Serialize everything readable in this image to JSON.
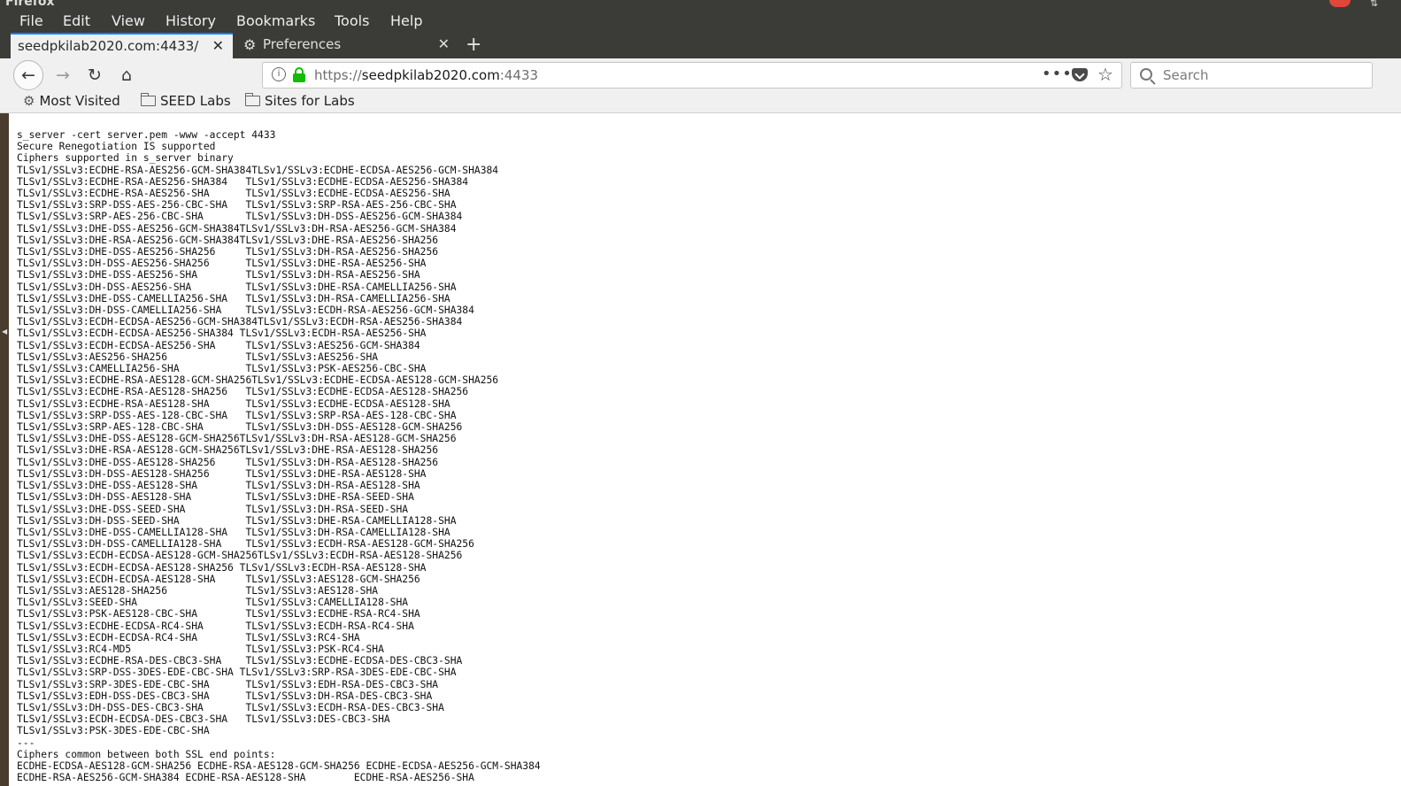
{
  "window": {
    "title": "Firefox"
  },
  "menu": [
    "File",
    "Edit",
    "View",
    "History",
    "Bookmarks",
    "Tools",
    "Help"
  ],
  "tabs": [
    {
      "label": "seedpkilab2020.com:4433/",
      "active": true
    },
    {
      "label": "Preferences",
      "active": false,
      "icon": "gear-icon"
    }
  ],
  "urlbar": {
    "scheme": "https://",
    "host": "seedpkilab2020.com",
    "port": ":4433",
    "page_actions": "•••"
  },
  "search": {
    "placeholder": "Search"
  },
  "bookmarks": [
    {
      "label": "Most Visited",
      "icon": "gear-icon"
    },
    {
      "label": "SEED Labs",
      "icon": "folder-icon"
    },
    {
      "label": "Sites for Labs",
      "icon": "folder-icon"
    }
  ],
  "page": {
    "lines": [
      "s_server -cert server.pem -www -accept 4433",
      "Secure Renegotiation IS supported",
      "Ciphers supported in s_server binary",
      "TLSv1/SSLv3:ECDHE-RSA-AES256-GCM-SHA384TLSv1/SSLv3:ECDHE-ECDSA-AES256-GCM-SHA384",
      "TLSv1/SSLv3:ECDHE-RSA-AES256-SHA384   TLSv1/SSLv3:ECDHE-ECDSA-AES256-SHA384",
      "TLSv1/SSLv3:ECDHE-RSA-AES256-SHA      TLSv1/SSLv3:ECDHE-ECDSA-AES256-SHA",
      "TLSv1/SSLv3:SRP-DSS-AES-256-CBC-SHA   TLSv1/SSLv3:SRP-RSA-AES-256-CBC-SHA",
      "TLSv1/SSLv3:SRP-AES-256-CBC-SHA       TLSv1/SSLv3:DH-DSS-AES256-GCM-SHA384",
      "TLSv1/SSLv3:DHE-DSS-AES256-GCM-SHA384TLSv1/SSLv3:DH-RSA-AES256-GCM-SHA384",
      "TLSv1/SSLv3:DHE-RSA-AES256-GCM-SHA384TLSv1/SSLv3:DHE-RSA-AES256-SHA256",
      "TLSv1/SSLv3:DHE-DSS-AES256-SHA256     TLSv1/SSLv3:DH-RSA-AES256-SHA256",
      "TLSv1/SSLv3:DH-DSS-AES256-SHA256      TLSv1/SSLv3:DHE-RSA-AES256-SHA",
      "TLSv1/SSLv3:DHE-DSS-AES256-SHA        TLSv1/SSLv3:DH-RSA-AES256-SHA",
      "TLSv1/SSLv3:DH-DSS-AES256-SHA         TLSv1/SSLv3:DHE-RSA-CAMELLIA256-SHA",
      "TLSv1/SSLv3:DHE-DSS-CAMELLIA256-SHA   TLSv1/SSLv3:DH-RSA-CAMELLIA256-SHA",
      "TLSv1/SSLv3:DH-DSS-CAMELLIA256-SHA    TLSv1/SSLv3:ECDH-RSA-AES256-GCM-SHA384",
      "TLSv1/SSLv3:ECDH-ECDSA-AES256-GCM-SHA384TLSv1/SSLv3:ECDH-RSA-AES256-SHA384",
      "TLSv1/SSLv3:ECDH-ECDSA-AES256-SHA384 TLSv1/SSLv3:ECDH-RSA-AES256-SHA",
      "TLSv1/SSLv3:ECDH-ECDSA-AES256-SHA     TLSv1/SSLv3:AES256-GCM-SHA384",
      "TLSv1/SSLv3:AES256-SHA256             TLSv1/SSLv3:AES256-SHA",
      "TLSv1/SSLv3:CAMELLIA256-SHA           TLSv1/SSLv3:PSK-AES256-CBC-SHA",
      "TLSv1/SSLv3:ECDHE-RSA-AES128-GCM-SHA256TLSv1/SSLv3:ECDHE-ECDSA-AES128-GCM-SHA256",
      "TLSv1/SSLv3:ECDHE-RSA-AES128-SHA256   TLSv1/SSLv3:ECDHE-ECDSA-AES128-SHA256",
      "TLSv1/SSLv3:ECDHE-RSA-AES128-SHA      TLSv1/SSLv3:ECDHE-ECDSA-AES128-SHA",
      "TLSv1/SSLv3:SRP-DSS-AES-128-CBC-SHA   TLSv1/SSLv3:SRP-RSA-AES-128-CBC-SHA",
      "TLSv1/SSLv3:SRP-AES-128-CBC-SHA       TLSv1/SSLv3:DH-DSS-AES128-GCM-SHA256",
      "TLSv1/SSLv3:DHE-DSS-AES128-GCM-SHA256TLSv1/SSLv3:DH-RSA-AES128-GCM-SHA256",
      "TLSv1/SSLv3:DHE-RSA-AES128-GCM-SHA256TLSv1/SSLv3:DHE-RSA-AES128-SHA256",
      "TLSv1/SSLv3:DHE-DSS-AES128-SHA256     TLSv1/SSLv3:DH-RSA-AES128-SHA256",
      "TLSv1/SSLv3:DH-DSS-AES128-SHA256      TLSv1/SSLv3:DHE-RSA-AES128-SHA",
      "TLSv1/SSLv3:DHE-DSS-AES128-SHA        TLSv1/SSLv3:DH-RSA-AES128-SHA",
      "TLSv1/SSLv3:DH-DSS-AES128-SHA         TLSv1/SSLv3:DHE-RSA-SEED-SHA",
      "TLSv1/SSLv3:DHE-DSS-SEED-SHA          TLSv1/SSLv3:DH-RSA-SEED-SHA",
      "TLSv1/SSLv3:DH-DSS-SEED-SHA           TLSv1/SSLv3:DHE-RSA-CAMELLIA128-SHA",
      "TLSv1/SSLv3:DHE-DSS-CAMELLIA128-SHA   TLSv1/SSLv3:DH-RSA-CAMELLIA128-SHA",
      "TLSv1/SSLv3:DH-DSS-CAMELLIA128-SHA    TLSv1/SSLv3:ECDH-RSA-AES128-GCM-SHA256",
      "TLSv1/SSLv3:ECDH-ECDSA-AES128-GCM-SHA256TLSv1/SSLv3:ECDH-RSA-AES128-SHA256",
      "TLSv1/SSLv3:ECDH-ECDSA-AES128-SHA256 TLSv1/SSLv3:ECDH-RSA-AES128-SHA",
      "TLSv1/SSLv3:ECDH-ECDSA-AES128-SHA     TLSv1/SSLv3:AES128-GCM-SHA256",
      "TLSv1/SSLv3:AES128-SHA256             TLSv1/SSLv3:AES128-SHA",
      "TLSv1/SSLv3:SEED-SHA                  TLSv1/SSLv3:CAMELLIA128-SHA",
      "TLSv1/SSLv3:PSK-AES128-CBC-SHA        TLSv1/SSLv3:ECDHE-RSA-RC4-SHA",
      "TLSv1/SSLv3:ECDHE-ECDSA-RC4-SHA       TLSv1/SSLv3:ECDH-RSA-RC4-SHA",
      "TLSv1/SSLv3:ECDH-ECDSA-RC4-SHA        TLSv1/SSLv3:RC4-SHA",
      "TLSv1/SSLv3:RC4-MD5                   TLSv1/SSLv3:PSK-RC4-SHA",
      "TLSv1/SSLv3:ECDHE-RSA-DES-CBC3-SHA    TLSv1/SSLv3:ECDHE-ECDSA-DES-CBC3-SHA",
      "TLSv1/SSLv3:SRP-DSS-3DES-EDE-CBC-SHA TLSv1/SSLv3:SRP-RSA-3DES-EDE-CBC-SHA",
      "TLSv1/SSLv3:SRP-3DES-EDE-CBC-SHA      TLSv1/SSLv3:EDH-RSA-DES-CBC3-SHA",
      "TLSv1/SSLv3:EDH-DSS-DES-CBC3-SHA      TLSv1/SSLv3:DH-RSA-DES-CBC3-SHA",
      "TLSv1/SSLv3:DH-DSS-DES-CBC3-SHA       TLSv1/SSLv3:ECDH-RSA-DES-CBC3-SHA",
      "TLSv1/SSLv3:ECDH-ECDSA-DES-CBC3-SHA   TLSv1/SSLv3:DES-CBC3-SHA",
      "TLSv1/SSLv3:PSK-3DES-EDE-CBC-SHA",
      "---",
      "Ciphers common between both SSL end points:",
      "ECDHE-ECDSA-AES128-GCM-SHA256 ECDHE-RSA-AES128-GCM-SHA256 ECDHE-ECDSA-AES256-GCM-SHA384",
      "ECDHE-RSA-AES256-GCM-SHA384 ECDHE-RSA-AES128-SHA        ECDHE-RSA-AES256-SHA"
    ]
  }
}
